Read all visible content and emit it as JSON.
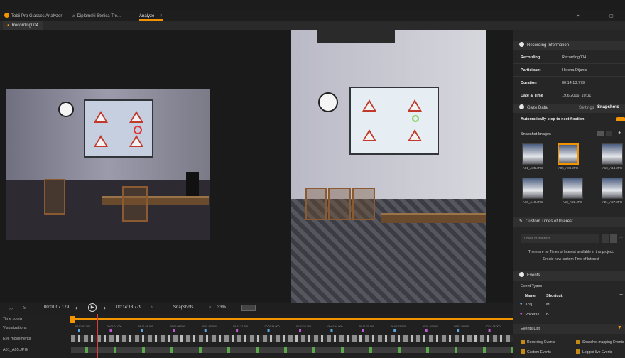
{
  "window": {
    "tabs": [
      {
        "label": "Tobii Pro Glasses Analyzer"
      },
      {
        "label": "Diplomski Štefica Tre..."
      },
      {
        "label": "Analyze"
      }
    ],
    "close_glyph": "×",
    "controls": {
      "pin_glyph": "⌖",
      "minimize_glyph": "—",
      "restore_glyph": "▢"
    }
  },
  "recording_tab": "Recording004",
  "recording_info": {
    "title": "Recording Information",
    "rows": [
      {
        "key": "Recording",
        "value": "Recording004"
      },
      {
        "key": "Participant",
        "value": "Helena Dijanic"
      },
      {
        "key": "Duration",
        "value": "00:14:13.779"
      },
      {
        "key": "Date & Time",
        "value": "19.6.2016. 10:01"
      }
    ]
  },
  "gaze_data": {
    "title": "Gaze Data",
    "tabs": [
      "Settings",
      "Snapshots"
    ],
    "active_tab": "Snapshots",
    "auto_step_label": "Automatically step to next fixation",
    "auto_step_on": true,
    "snapshot_images_label": "Snapshot Images",
    "thumbnails": [
      "A01_A05.JPG",
      "A05_A08.JPG",
      "A10_A13.JPG",
      "A16_A10.JPG",
      "A18_A22.JPG",
      "A21_A27.JPG"
    ]
  },
  "custom_times": {
    "title": "Custom Times of Interest",
    "dropdown_label": "Times of Interest",
    "empty_text": "There are no Times of Interest available in this project.",
    "create_text": "Create new custom Time of Interest"
  },
  "events": {
    "title": "Events",
    "event_types_label": "Event Types",
    "columns": [
      "Name",
      "Shortcut"
    ],
    "types": [
      {
        "name": "Kraj",
        "shortcut": "M",
        "color": "#5aa6e0"
      },
      {
        "name": "Pocetak",
        "shortcut": "B",
        "color": "#c25ad6"
      }
    ],
    "events_list_label": "Events List",
    "filters": [
      "Recording Events",
      "Snapshot mapping Events",
      "Custom Events",
      "Logged live Events"
    ]
  },
  "playback": {
    "current_time": "00:01:07.179",
    "total_time": "00:14:13.779",
    "snapshots_label": "Snapshots",
    "zoom": "33%",
    "progress": 0.06
  },
  "timeline": {
    "time_zoom_label": "Time zoom",
    "visualizations_label": "Visualizations",
    "eye_movements_label": "Eye movements",
    "snapshot_row_label": "A01_A05.JPG",
    "ticks": [
      "00:01:02.000",
      "00:01:04.000",
      "00:01:06.000",
      "00:01:08.000",
      "00:01:10.000",
      "00:01:12.000",
      "00:01:14.000",
      "00:01:16.000",
      "00:01:18.000",
      "00:01:20.000",
      "00:01:22.000",
      "00:01:24.000",
      "00:01:26.000",
      "00:01:28.000"
    ]
  },
  "colors": {
    "accent": "#f29400",
    "gaze_green": "#7bd35a",
    "gaze_red": "#e03a3a"
  }
}
